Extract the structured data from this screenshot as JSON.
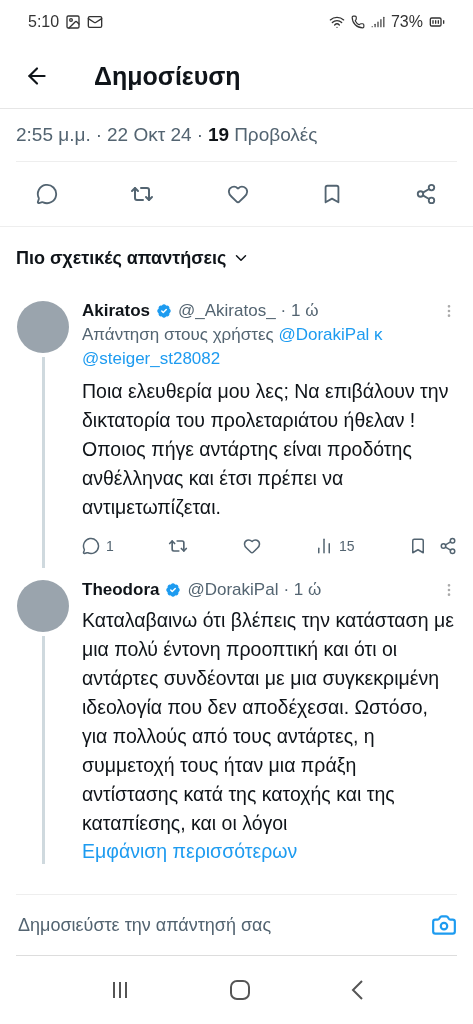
{
  "status_bar": {
    "time": "5:10",
    "battery": "73%"
  },
  "header": {
    "title": "Δημοσίευση"
  },
  "post_meta": {
    "time": "2:55 μ.μ.",
    "separator_1": "·",
    "date": "22 Οκτ 24",
    "separator_2": "·",
    "views_count": "19",
    "views_label": "Προβολές"
  },
  "post_actions": [
    {
      "kind": "reply"
    },
    {
      "kind": "repost"
    },
    {
      "kind": "like"
    },
    {
      "kind": "bookmark"
    },
    {
      "kind": "share"
    }
  ],
  "replies_heading": "Πιο σχετικές απαντήσεις",
  "replies": [
    {
      "name": "Akiratos",
      "verified": true,
      "handle": "@_Akiratos_",
      "age": "· 1 ώ",
      "thread_line": true,
      "reply_to": {
        "prefix": "Απάντηση στους χρήστες",
        "mentions": [
          "@DorakiPal",
          "@steiger_st28082"
        ],
        "joiner": "κ"
      },
      "text": "Ποια ελευθερία μου λες; Να επιβάλουν την δικτατορία του προλεταριάτου ήθελαν ! Οποιος πήγε αντάρτης είναι προδότης ανθέλληνας και έτσι πρέπει να αντιμετωπίζεται.",
      "stats": {
        "replies": "1",
        "views": "15"
      }
    },
    {
      "name": "Theodora",
      "verified": true,
      "handle": "@DorakiPal",
      "age": "· 1 ώ",
      "thread_line": true,
      "text": "Καταλαβαινω ότι βλέπεις την κατάσταση με μια πολύ έντονη προοπτική και ότι οι αντάρτες συνδέονται με μια συγκεκριμένη ιδεολογία που δεν αποδέχεσαι. Ωστόσο, για πολλούς από τους αντάρτες, η συμμετοχή τους ήταν μια πράξη αντίστασης κατά της κατοχής και της καταπίεσης, και οι λόγοι",
      "show_more": "Εμφάνιση περισσότερων"
    }
  ],
  "composer": {
    "placeholder": "Δημοσιεύστε την απάντησή σας"
  }
}
